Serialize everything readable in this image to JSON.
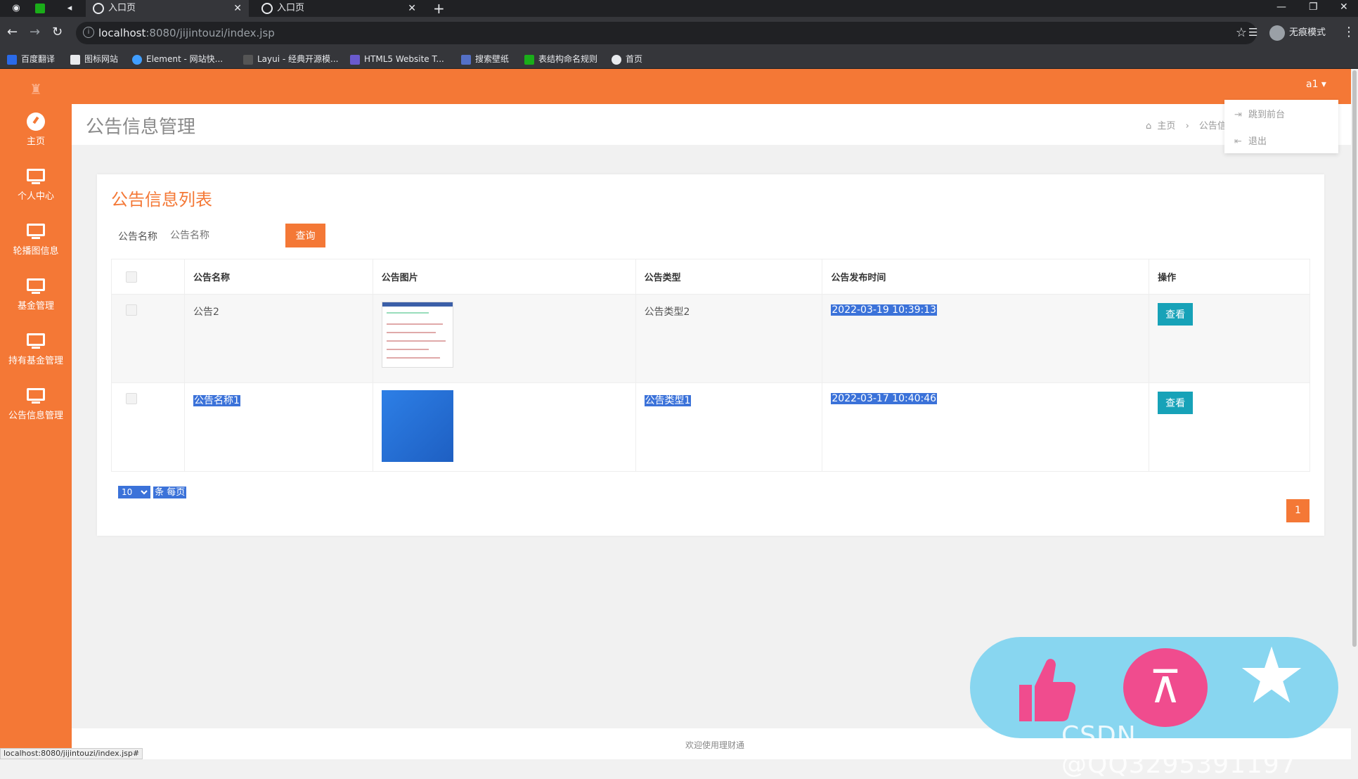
{
  "browser": {
    "tabs": [
      {
        "label": "入口页",
        "active": true
      },
      {
        "label": "入口页",
        "active": false
      }
    ],
    "url_host": "localhost",
    "url_rest": ":8080/jijintouzi/index.jsp",
    "profile_label": "无痕模式",
    "bookmarks": [
      {
        "label": "百度翻译",
        "color": "#2a6ae8"
      },
      {
        "label": "图标网站",
        "color": "#e8eaed"
      },
      {
        "label": "Element - 网站快...",
        "color": "#409eff"
      },
      {
        "label": "Layui - 经典开源模...",
        "color": "#e8eaed"
      },
      {
        "label": "HTML5 Website T...",
        "color": "#6a5acd"
      },
      {
        "label": "搜索壁纸",
        "color": "#5470c6"
      },
      {
        "label": "表结构命名规则",
        "color": "#1aad19"
      },
      {
        "label": "首页",
        "color": "#e8eaed"
      }
    ]
  },
  "app": {
    "user_menu": "a1 ▾",
    "dropdown": {
      "item1": "跳到前台",
      "item2": "退出"
    },
    "sidebar": [
      {
        "label": "主页",
        "icon": "dashboard-icon"
      },
      {
        "label": "个人中心",
        "icon": "monitor-icon"
      },
      {
        "label": "轮播图信息",
        "icon": "monitor-icon"
      },
      {
        "label": "基金管理",
        "icon": "monitor-icon"
      },
      {
        "label": "持有基金管理",
        "icon": "monitor-icon"
      },
      {
        "label": "公告信息管理",
        "icon": "monitor-icon"
      }
    ],
    "page_title": "公告信息管理",
    "breadcrumb": {
      "home": "主页",
      "sep": "›",
      "current": "公告信"
    },
    "panel_title": "公告信息列表",
    "search": {
      "label": "公告名称",
      "placeholder": "公告名称",
      "button": "查询"
    },
    "table": {
      "headers": [
        "公告名称",
        "公告图片",
        "公告类型",
        "公告发布时间",
        "操作"
      ],
      "rows": [
        {
          "name": "公告2",
          "type": "公告类型2",
          "time": "2022-03-19 10:39:13",
          "action": "查看"
        },
        {
          "name": "公告名称1",
          "type": "公告类型1",
          "time": "2022-03-17 10:40:46",
          "action": "查看"
        }
      ]
    },
    "pager": {
      "size": "10",
      "size_label": "条 每页",
      "current_page": "1"
    },
    "footer": "欢迎使用理财通",
    "status_url": "localhost:8080/jijintouzi/index.jsp#"
  },
  "overlay": {
    "watermark": "CSDN @QQ3295391197"
  },
  "colors": {
    "accent": "#f47836",
    "view_button": "#17a2b8",
    "selection": "#3b72d9"
  }
}
